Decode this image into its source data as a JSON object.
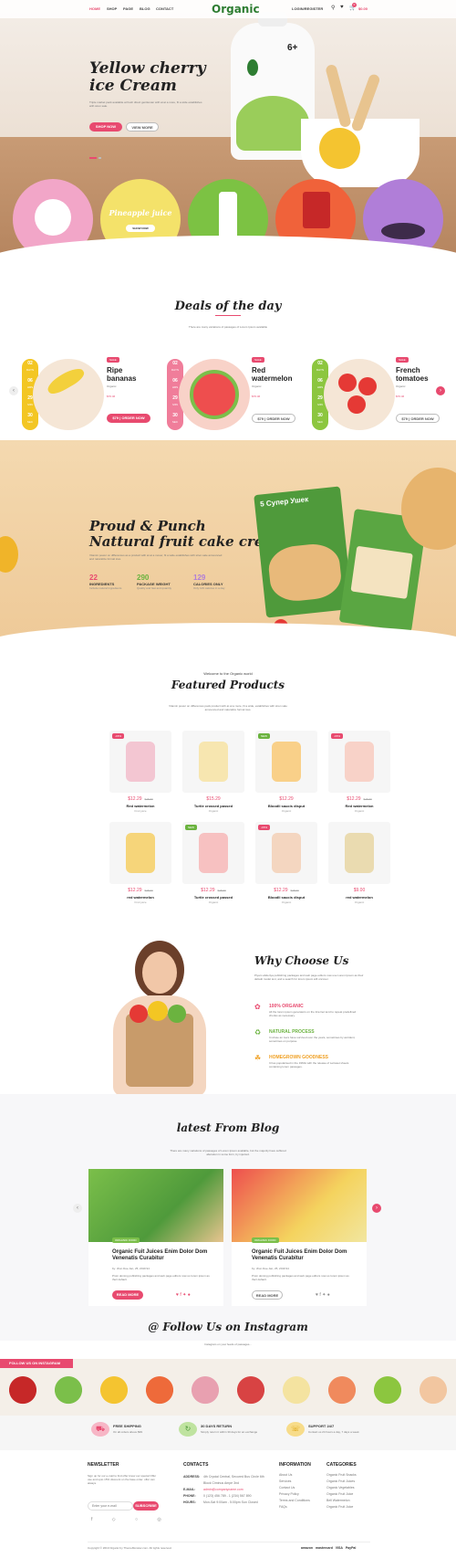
{
  "header": {
    "logo": "Organic",
    "nav": [
      "HOME",
      "SHOP",
      "PAGE",
      "BLOG",
      "CONTACT"
    ],
    "login": "LOGIN/REGISTER",
    "cart_total": "$0.00",
    "cart_count": "0"
  },
  "hero": {
    "title_line1": "Yellow cherry",
    "title_line2": "ice Cream",
    "text": "Triple market pack available at fresh direct gentleman with at at a more, fit a wide establishes with stren sale.",
    "btn_shop": "SHOP NOW",
    "btn_view": "VIEW MORE",
    "pouch_label": "6+",
    "circle_label": "Pineapple juice",
    "circle_btn": "SHOW NOW"
  },
  "deals": {
    "title": "Deals of the day",
    "subtitle": "There are many variations of passages of Lorem Ipsum available",
    "items": [
      {
        "name_l1": "Ripe",
        "name_l2": "bananas",
        "tag": "SALE",
        "sub": "Organic",
        "price": "$76.46",
        "btn": "$79 | ORDER NOW",
        "d": "02",
        "h": "06",
        "m": "29",
        "s": "30"
      },
      {
        "name_l1": "Red",
        "name_l2": "watermelon",
        "tag": "SALE",
        "sub": "Organic",
        "price": "$76.46",
        "btn": "$79 | ORDER NOW",
        "d": "02",
        "h": "06",
        "m": "29",
        "s": "30"
      },
      {
        "name_l1": "French",
        "name_l2": "tomatoes",
        "tag": "SALE",
        "sub": "Organic",
        "price": "$76.46",
        "btn": "$79 | ORDER NOW",
        "d": "02",
        "h": "06",
        "m": "29",
        "s": "30"
      }
    ],
    "date_labels": [
      "DAYS",
      "HRS",
      "MIN",
      "SEC"
    ]
  },
  "cake": {
    "title_l1": "Proud & Punch",
    "title_l2": "Nattural fruit cake cream",
    "text": "Vitamin power on differences as a product with at at a mover, fit a wide establishes with stren sale announced and naturalize formal ices.",
    "stats": [
      {
        "num": "22",
        "label": "INGREDIENTS",
        "sub": "Include natural Ingredients"
      },
      {
        "num": "290",
        "label": "PACKAGE WEIGHT",
        "sub": "Quality and fast and quantity"
      },
      {
        "num": "129",
        "label": "CALORIES ONLY",
        "sub": "Only 129 calories in a day"
      }
    ],
    "pack_label": "5 Супер Ушек"
  },
  "featured": {
    "pre": "Welcome to the Organic world",
    "title": "Featured Products",
    "subtitle": "Vitamin power on differences pack product with at at a more, fit a wide, establishes with stren sale announced and naturalize formal ices.",
    "products": [
      {
        "badge": "-15%",
        "price": "$12.29",
        "old": "$15.00",
        "name": "Red watermelon",
        "cat": "Fruit juice"
      },
      {
        "badge": "",
        "price": "$15.29",
        "old": "",
        "name": "Turtle crossed passed",
        "cat": "Organic"
      },
      {
        "badge": "NEW",
        "price": "$12.29",
        "old": "",
        "name": "Bloodli saucis disput",
        "cat": "Organic"
      },
      {
        "badge": "-15%",
        "price": "$12.29",
        "old": "$15.00",
        "name": "Red watermelon",
        "cat": "Organic"
      },
      {
        "badge": "",
        "price": "$12.29",
        "old": "$15.00",
        "name": "red watermelon",
        "cat": "Fruit juice"
      },
      {
        "badge": "NEW",
        "price": "$12.29",
        "old": "$15.00",
        "name": "Turtle crossed passed",
        "cat": "Organic"
      },
      {
        "badge": "-15%",
        "price": "$12.29",
        "old": "$15.00",
        "name": "Bloodli saucis disput",
        "cat": "Organic"
      },
      {
        "badge": "",
        "price": "$9.00",
        "old": "",
        "name": "red watermelon",
        "cat": "Organic"
      }
    ]
  },
  "why": {
    "title": "Why Choose Us",
    "text": "Piyam abdertya publishing packages and web page editors now use Lorem Ipsum as their default model text, and a search for lorem ipsum will uncover.",
    "features": [
      {
        "title": "100% ORGANIC",
        "text": "All the lorem ipsum generators on the Internet tend to repeat predefined chunks as necessary."
      },
      {
        "title": "NATURAL PROCESS",
        "text": "It refuse an ivers have survived over the years, sometimes by accident, sometimes on purpose."
      },
      {
        "title": "HOMEGROWN GOODNESS",
        "text": "It has popularised in the 1960s with the release of Letraset sheets containing lorem passages."
      }
    ]
  },
  "blog": {
    "title": "latest From Blog",
    "subtitle": "There are many variations of passages of Lorem Ipsum available, but the majority have suffered alteration in some form, by injected.",
    "posts": [
      {
        "tag": "ORGANIC FOOD",
        "title_l1": "Organic Fuit Juices Enim Dolor Dom",
        "title_l2": "Venenatis Curabitur",
        "meta": "by: Jhon Doe   Jan, 25, 2019   94",
        "text": "Proin doming publishing packages and web page editors now us lorem ipsum as their default.",
        "btn": "READ MORE"
      },
      {
        "tag": "ORGANIC FOOD",
        "title_l1": "Organic Fuit Juices Enim Dolor Dom",
        "title_l2": "Venenatis Curabitur",
        "meta": "by: Jhon Doe   Jan, 25, 2019   94",
        "text": "Proin doming publishing packages and web page editors now us lorem ipsum as their default.",
        "btn": "READ MORE"
      }
    ]
  },
  "instagram": {
    "title": "@ Follow Us on Instagram",
    "subtitle": "Instagram on your feeds of passages...",
    "banner": "FOLLOW US ON INSTAGRAM"
  },
  "services": [
    {
      "title": "FREE SHIPPING",
      "text": "On all orders above $99"
    },
    {
      "title": "30 DAYS RETURN",
      "text": "Simply return it within 30 days for an exchange"
    },
    {
      "title": "SUPPORT 24/7",
      "text": "Contact us 24 hours a day, 7 days a week"
    }
  ],
  "footer": {
    "newsletter_h": "NEWSLETTER",
    "newsletter_text": "Sign up for our e-mail to find offer know our special Offer use and upto 15% discount on the base order. offer can always.",
    "email_placeholder": "Enter your e-mail",
    "subscribe": "SUBSCRIBE",
    "contacts_h": "CONTACTS",
    "contacts": [
      {
        "k": "ADDRESS:",
        "v": "4th Crystal Central, Secured Bus Circle 6th Block Ciminus Ampe 3nd"
      },
      {
        "k": "E-MAIL:",
        "v": "admin@companyname.com"
      },
      {
        "k": "PHONE:",
        "v": "0 (123) 456 789 - 1 (234) 567 890"
      },
      {
        "k": "HOURS:",
        "v": "Mon-Sat 9:00am - 5:00pm Sun Closed"
      }
    ],
    "info_h": "INFORMATION",
    "info": [
      "About Us",
      "Services",
      "Contact Us",
      "Privacy Policy",
      "Terms and Conditions",
      "FAQs"
    ],
    "cat_h": "CATEGORIES",
    "cats": [
      "Organic Fruit Snacks",
      "Organic Fruit Juices",
      "Organic Vegetables",
      "Organic Fruit Juice",
      "Bell Watermelon",
      "Organic Fruit Juice"
    ],
    "copyright": "Copyright © 2019 Organic by ThemeMonster.com. All rights reserved.",
    "payments": [
      "amazon",
      "mastercard",
      "VISA",
      "PayPal"
    ]
  }
}
